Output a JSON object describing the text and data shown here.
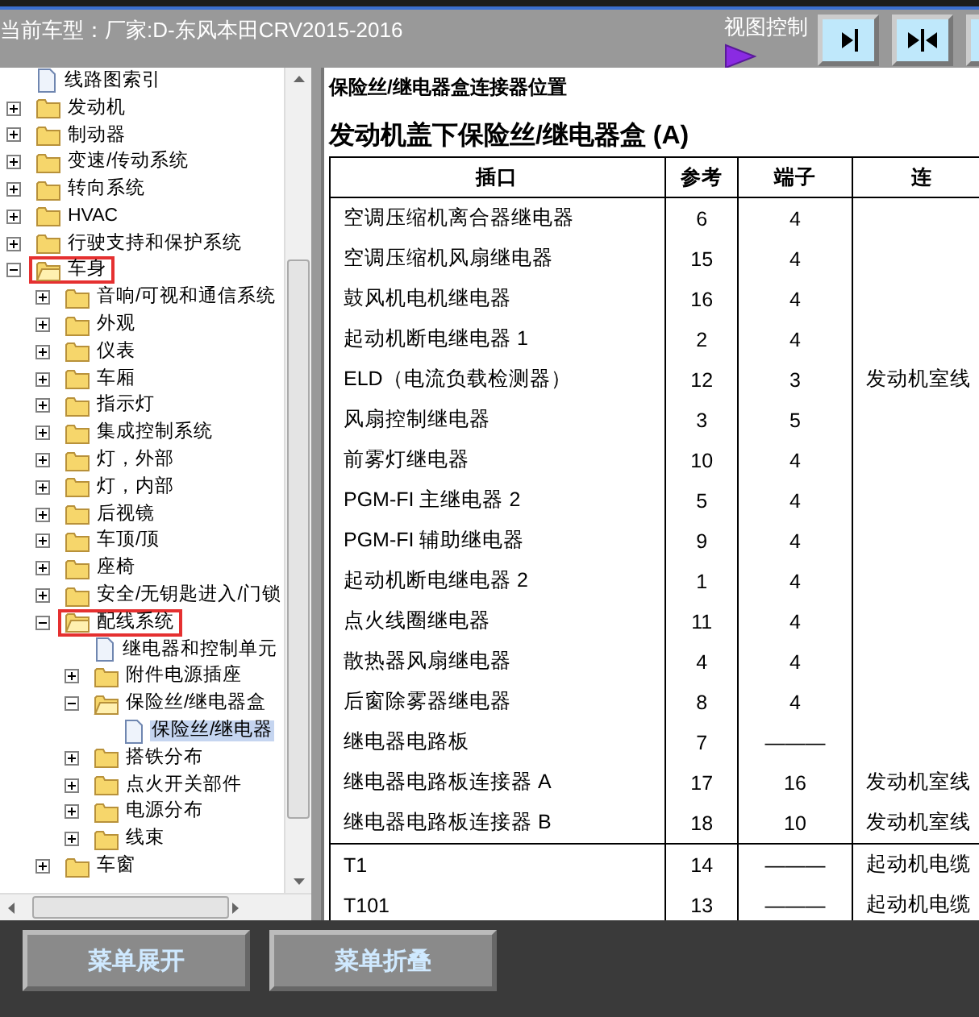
{
  "header": {
    "vehicle": "当前车型：厂家:D-东风本田CRV2015-2016",
    "view_control_label": "视图控制"
  },
  "tree": [
    {
      "label": "线路图索引",
      "kind": "document",
      "selected": false,
      "highlighted": false
    },
    {
      "label": "发动机",
      "kind": "folder",
      "expanded": false,
      "selected": false,
      "highlighted": false
    },
    {
      "label": "制动器",
      "kind": "folder",
      "expanded": false,
      "selected": false,
      "highlighted": false
    },
    {
      "label": "变速/传动系统",
      "kind": "folder",
      "expanded": false,
      "selected": false,
      "highlighted": false
    },
    {
      "label": "转向系统",
      "kind": "folder",
      "expanded": false,
      "selected": false,
      "highlighted": false
    },
    {
      "label": "HVAC",
      "kind": "folder",
      "expanded": false,
      "selected": false,
      "highlighted": false
    },
    {
      "label": "行驶支持和保护系统",
      "kind": "folder",
      "expanded": false,
      "selected": false,
      "highlighted": false
    },
    {
      "label": "车身",
      "kind": "folder",
      "expanded": true,
      "selected": false,
      "highlighted": true,
      "children": [
        {
          "label": "音响/可视和通信系统",
          "kind": "folder",
          "expanded": false,
          "selected": false,
          "highlighted": false
        },
        {
          "label": "外观",
          "kind": "folder",
          "expanded": false,
          "selected": false,
          "highlighted": false
        },
        {
          "label": "仪表",
          "kind": "folder",
          "expanded": false,
          "selected": false,
          "highlighted": false
        },
        {
          "label": "车厢",
          "kind": "folder",
          "expanded": false,
          "selected": false,
          "highlighted": false
        },
        {
          "label": "指示灯",
          "kind": "folder",
          "expanded": false,
          "selected": false,
          "highlighted": false
        },
        {
          "label": "集成控制系统",
          "kind": "folder",
          "expanded": false,
          "selected": false,
          "highlighted": false
        },
        {
          "label": "灯，外部",
          "kind": "folder",
          "expanded": false,
          "selected": false,
          "highlighted": false
        },
        {
          "label": "灯，内部",
          "kind": "folder",
          "expanded": false,
          "selected": false,
          "highlighted": false
        },
        {
          "label": "后视镜",
          "kind": "folder",
          "expanded": false,
          "selected": false,
          "highlighted": false
        },
        {
          "label": "车顶/顶",
          "kind": "folder",
          "expanded": false,
          "selected": false,
          "highlighted": false
        },
        {
          "label": "座椅",
          "kind": "folder",
          "expanded": false,
          "selected": false,
          "highlighted": false
        },
        {
          "label": "安全/无钥匙进入/门锁",
          "kind": "folder",
          "expanded": false,
          "selected": false,
          "highlighted": false
        },
        {
          "label": "配线系统",
          "kind": "folder",
          "expanded": true,
          "selected": false,
          "highlighted": true,
          "children": [
            {
              "label": "继电器和控制单元",
              "kind": "document",
              "selected": false,
              "highlighted": false
            },
            {
              "label": "附件电源插座",
              "kind": "folder",
              "expanded": false,
              "selected": false,
              "highlighted": false
            },
            {
              "label": "保险丝/继电器盒",
              "kind": "folder",
              "expanded": true,
              "selected": false,
              "highlighted": false,
              "children": [
                {
                  "label": "保险丝/继电器",
                  "kind": "document",
                  "selected": true,
                  "highlighted": false
                }
              ]
            },
            {
              "label": "搭铁分布",
              "kind": "folder",
              "expanded": false,
              "selected": false,
              "highlighted": false
            },
            {
              "label": "点火开关部件",
              "kind": "folder",
              "expanded": false,
              "selected": false,
              "highlighted": false
            },
            {
              "label": "电源分布",
              "kind": "folder",
              "expanded": false,
              "selected": false,
              "highlighted": false
            },
            {
              "label": "线束",
              "kind": "folder",
              "expanded": false,
              "selected": false,
              "highlighted": false
            }
          ]
        },
        {
          "label": "车窗",
          "kind": "folder",
          "expanded": false,
          "selected": false,
          "highlighted": false
        }
      ]
    }
  ],
  "content": {
    "title": "保险丝/继电器盒连接器位置",
    "heading": "发动机盖下保险丝/继电器盒 (A)",
    "table": {
      "columns": [
        "插口",
        "参考",
        "端子",
        "连"
      ],
      "row_groups": [
        [
          {
            "socket": "空调压缩机离合器继电器",
            "reference": "6",
            "terminals": "4"
          },
          {
            "socket": "空调压缩机风扇继电器",
            "reference": "15",
            "terminals": "4"
          },
          {
            "socket": "鼓风机电机继电器",
            "reference": "16",
            "terminals": "4"
          },
          {
            "socket": "起动机断电继电器 1",
            "reference": "2",
            "terminals": "4"
          },
          {
            "socket": "ELD（电流负载检测器）",
            "reference": "12",
            "terminals": "3",
            "connection": "发动机室线"
          },
          {
            "socket": "风扇控制继电器",
            "reference": "3",
            "terminals": "5"
          },
          {
            "socket": "前雾灯继电器",
            "reference": "10",
            "terminals": "4"
          },
          {
            "socket": "PGM-FI 主继电器 2",
            "reference": "5",
            "terminals": "4"
          },
          {
            "socket": "PGM-FI 辅助继电器",
            "reference": "9",
            "terminals": "4"
          },
          {
            "socket": "起动机断电继电器 2",
            "reference": "1",
            "terminals": "4"
          },
          {
            "socket": "点火线圈继电器",
            "reference": "11",
            "terminals": "4"
          },
          {
            "socket": "散热器风扇继电器",
            "reference": "4",
            "terminals": "4"
          },
          {
            "socket": "后窗除雾器继电器",
            "reference": "8",
            "terminals": "4"
          },
          {
            "socket": "继电器电路板",
            "reference": "7",
            "terminals": "———"
          },
          {
            "socket": "继电器电路板连接器 A",
            "reference": "17",
            "terminals": "16",
            "connection": "发动机室线"
          },
          {
            "socket": "继电器电路板连接器 B",
            "reference": "18",
            "terminals": "10",
            "connection": "发动机室线"
          }
        ],
        [
          {
            "socket": "T1",
            "reference": "14",
            "terminals": "———",
            "connection": "起动机电缆"
          },
          {
            "socket": "T101",
            "reference": "13",
            "terminals": "———",
            "connection": "起动机电缆"
          }
        ]
      ]
    }
  },
  "buttons": [
    "菜单展开",
    "菜单折叠"
  ]
}
